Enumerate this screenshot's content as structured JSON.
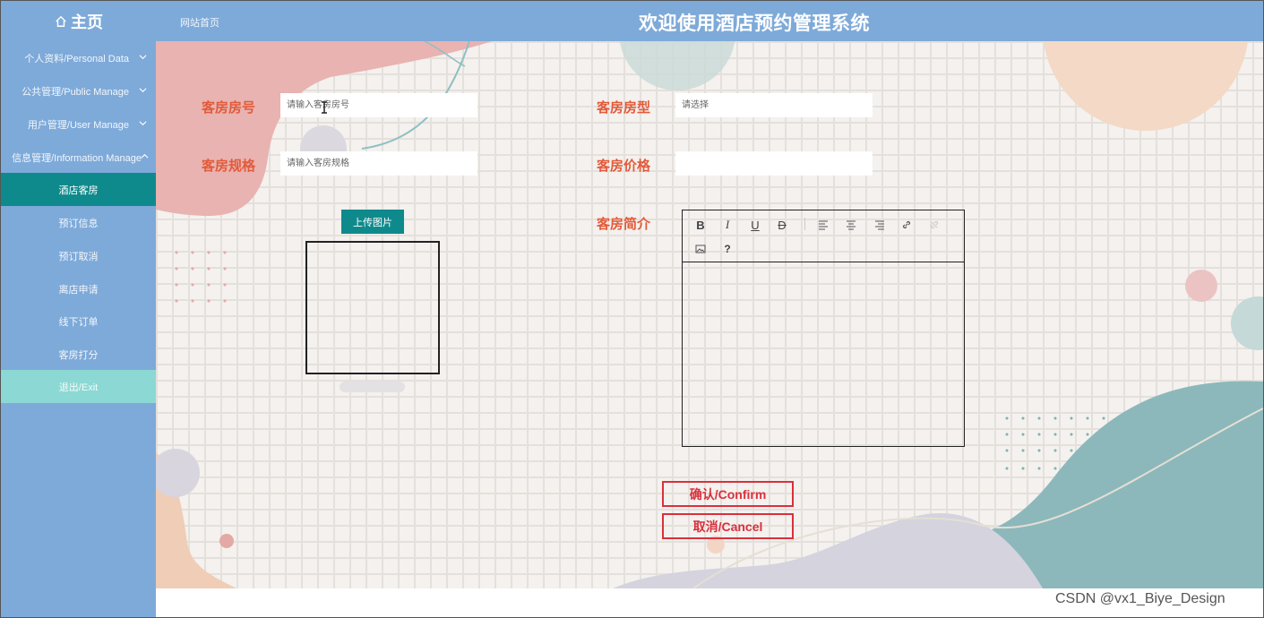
{
  "header": {
    "home_label": "主页",
    "breadcrumb": "网站首页",
    "title": "欢迎使用酒店预约管理系统"
  },
  "sidebar": {
    "groups": [
      {
        "label": "个人资料/Personal Data"
      },
      {
        "label": "公共管理/Public Manage"
      },
      {
        "label": "用户管理/User Manage"
      },
      {
        "label": "信息管理/Information Manage"
      }
    ],
    "items": [
      {
        "label": "酒店客房"
      },
      {
        "label": "预订信息"
      },
      {
        "label": "预订取消"
      },
      {
        "label": "离店申请"
      },
      {
        "label": "线下订单"
      },
      {
        "label": "客房打分"
      },
      {
        "label": "退出/Exit"
      }
    ]
  },
  "form": {
    "room_no": {
      "label": "客房房号",
      "placeholder": "请输入客房房号",
      "value": ""
    },
    "room_type": {
      "label": "客房房型",
      "placeholder": "请选择",
      "value": ""
    },
    "room_spec": {
      "label": "客房规格",
      "placeholder": "请输入客房规格",
      "value": ""
    },
    "room_price": {
      "label": "客房价格",
      "placeholder": "",
      "value": ""
    },
    "room_intro": {
      "label": "客房简介"
    },
    "upload_label": "上传图片",
    "confirm_label": "确认/Confirm",
    "cancel_label": "取消/Cancel"
  },
  "editor": {
    "toolbar": [
      "bold-icon",
      "italic-icon",
      "underline-icon",
      "strikethrough-icon",
      "align-left-icon",
      "align-center-icon",
      "align-right-icon",
      "link-icon",
      "unlink-icon",
      "image-icon",
      "help-icon"
    ]
  },
  "colors": {
    "header_bg": "#7eaad9",
    "active_menu": "#0f8a8c",
    "exit_menu": "#8cd8d4",
    "label": "#e25a3a",
    "danger": "#d9303c"
  },
  "watermark": "CSDN @vx1_Biye_Design"
}
